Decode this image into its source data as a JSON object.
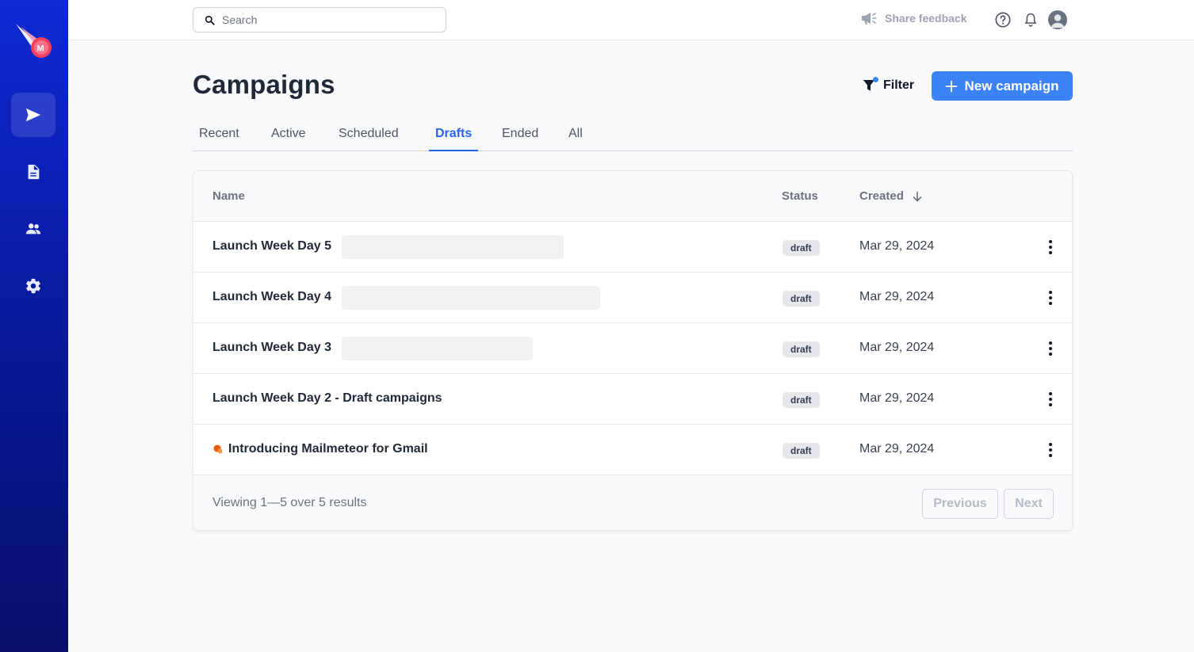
{
  "app": {
    "brand_color": "#0f2ad6",
    "accent_color": "#3b82f6",
    "logo_icon": "comet-logo"
  },
  "sidebar": {
    "items": [
      {
        "name": "campaigns",
        "icon": "send-icon",
        "active": true
      },
      {
        "name": "templates",
        "icon": "document-icon",
        "active": false
      },
      {
        "name": "contacts",
        "icon": "people-icon",
        "active": false
      },
      {
        "name": "settings",
        "icon": "gear-icon",
        "active": false
      }
    ]
  },
  "topbar": {
    "search_placeholder": "Search",
    "feedback_label": "Share feedback",
    "icons": [
      "megaphone-icon",
      "help-icon",
      "bell-icon",
      "avatar"
    ]
  },
  "header": {
    "title": "Campaigns",
    "filter_label": "Filter",
    "new_campaign_label": "New campaign"
  },
  "tabs": [
    {
      "label": "Recent",
      "active": false
    },
    {
      "label": "Active",
      "active": false
    },
    {
      "label": "Scheduled",
      "active": false
    },
    {
      "label": "Drafts",
      "active": true
    },
    {
      "label": "Ended",
      "active": false
    },
    {
      "label": "All",
      "active": false
    }
  ],
  "table": {
    "columns": {
      "name": "Name",
      "status": "Status",
      "created": "Created"
    },
    "rows": [
      {
        "name": "Launch Week Day 5",
        "status": "draft",
        "created": "Mar 29, 2024"
      },
      {
        "name": "Launch Week Day 4",
        "status": "draft",
        "created": "Mar 29, 2024"
      },
      {
        "name": "Launch Week Day 3",
        "status": "draft",
        "created": "Mar 29, 2024"
      },
      {
        "name": "Launch Week Day 2 - Draft campaigns",
        "status": "draft",
        "created": "Mar 29, 2024"
      },
      {
        "name": "Introducing Mailmeteor for Gmail",
        "status": "draft",
        "created": "Mar 29, 2024",
        "icon": "meteor-icon"
      }
    ]
  },
  "pagination": {
    "summary": "Viewing 1—5 over 5 results",
    "previous_label": "Previous",
    "next_label": "Next"
  }
}
